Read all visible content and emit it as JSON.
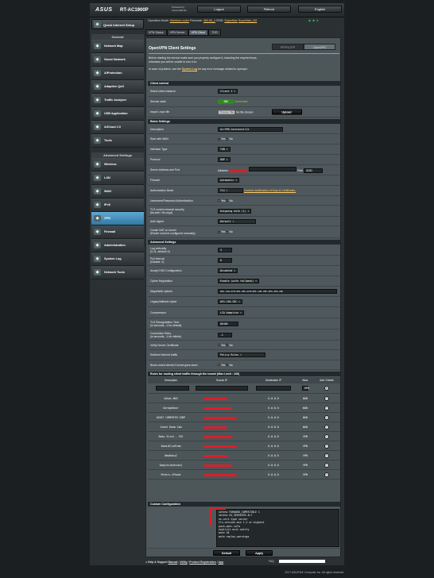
{
  "header": {
    "brand": "ASUS",
    "model": "RT-AC1900P",
    "powered_line1": "Powered by",
    "powered_line2": "AsuswrtMerlin",
    "logout": "Logout",
    "reboot": "Reboot",
    "language": "English"
  },
  "opmode": {
    "label": "Operation Mode:",
    "mode": "Wireless router",
    "fw_label": "Firmware:",
    "fw": "380.68_4",
    "ssid_label": "SSID:",
    "ssid1": "SuperMan",
    "ssid2": "SuperMan_5G"
  },
  "sidebar": {
    "qis": "Quick Internet Setup",
    "general": "General",
    "general_items": [
      {
        "label": "Network Map",
        "icon": "network-map-icon"
      },
      {
        "label": "Guest Network",
        "icon": "guest-network-icon"
      },
      {
        "label": "AiProtection",
        "icon": "shield-icon"
      },
      {
        "label": "Adaptive QoS",
        "icon": "qos-icon"
      },
      {
        "label": "Traffic Analyzer",
        "icon": "traffic-icon"
      },
      {
        "label": "USB Application",
        "icon": "usb-icon"
      },
      {
        "label": "AiCloud 2.0",
        "icon": "cloud-icon"
      },
      {
        "label": "Tools",
        "icon": "tools-icon"
      }
    ],
    "advanced": "Advanced Settings",
    "advanced_items": [
      {
        "label": "Wireless",
        "icon": "wireless-icon"
      },
      {
        "label": "LAN",
        "icon": "lan-icon"
      },
      {
        "label": "WAN",
        "icon": "wan-icon"
      },
      {
        "label": "IPv6",
        "icon": "ipv6-icon"
      },
      {
        "label": "VPN",
        "icon": "vpn-icon"
      },
      {
        "label": "Firewall",
        "icon": "firewall-icon"
      },
      {
        "label": "Administration",
        "icon": "admin-icon"
      },
      {
        "label": "System Log",
        "icon": "log-icon"
      },
      {
        "label": "Network Tools",
        "icon": "net-tools-icon"
      }
    ]
  },
  "tabs": [
    "VPN Status",
    "VPN Server",
    "VPN Client",
    "TOR"
  ],
  "page": {
    "title": "OpenVPN Client Settings",
    "switch_left": "PPTP/L2TP",
    "switch_right": "OpenVPN",
    "note1": "Before starting the service make sure you properly configure it, including the required keys,",
    "note2": "otherwise you will be unable to turn it on.",
    "note3a": "In case of problem, see the ",
    "note3_link": "System Log",
    "note3b": " for any error message related to openvpn."
  },
  "client_control": {
    "head": "Client control",
    "select_label": "Select client instance",
    "select_value": "Client 1",
    "state_label": "Service state",
    "state_value": "ON",
    "state_status": "Connected",
    "import_label": "Import .ovpn file",
    "choose": "Choose File",
    "no_file": "No file chosen",
    "upload": "Upload"
  },
  "basic": {
    "head": "Basic Settings",
    "desc_label": "Description",
    "desc_value": "AirVPN-Jacksonville",
    "start_label": "Start with WAN",
    "yes": "Yes",
    "no": "No",
    "iface_label": "Interface Type",
    "iface_value": "TUN",
    "proto_label": "Protocol",
    "proto_value": "UDP",
    "server_label": "Server Address and Port",
    "addr_label": "Address:",
    "port_label": "Port:",
    "port_value": "8282",
    "fw_label": "Firewall",
    "fw_value": "Automatic",
    "auth_label": "Authorization Mode",
    "auth_value": "TLS",
    "auth_link": "Content modification of Keys & Certificates.",
    "userpass_label": "Username/Password Authentication",
    "tls_label": "TLS control channel security\n(tls-auth / tls-crypt)",
    "tls_value": "Outgoing Auth (1)",
    "digest_label": "Auth digest",
    "digest_value": "Default",
    "nat_label": "Create NAT on tunnel\n(Router must be configured manually)"
  },
  "advanced": {
    "head": "Advanced Settings",
    "verb_label": "Log verbosity\n(0-11, default=3)",
    "verb_value": "3",
    "poll_label": "Poll Interval\n(Disable: 0)",
    "poll_value": "0",
    "dns_label": "Accept DNS Configuration",
    "dns_value": "Disabled",
    "cipher_neg_label": "Cipher Negotiation",
    "cipher_neg_value": "Enable (with fallback)",
    "ciphers_label": "Negotiable ciphers",
    "ciphers_value": "AES-128-GCM:AES-256-GCM:AES-128-CBC:AES-256-CBC",
    "legacy_label": "Legacy/fallback cipher",
    "legacy_value": "AES-256-CBC",
    "comp_label": "Compression",
    "comp_value": "LZO Adaptive",
    "reneg_label": "TLS Renegotiation Time\n(in seconds, -1 for default)",
    "reneg_value": "86400",
    "retry_label": "Connection Retry\n(in seconds, -1 for infinite)",
    "retry_value": "-1",
    "verify_label": "Verify Server Certificate",
    "redirect_label": "Redirect Internet traffic",
    "redirect_value": "Policy Rules",
    "block_label": "Block routed clients if tunnel goes down"
  },
  "rules": {
    "head": "Rules for routing client traffic through the tunnel (Max Limit : 100)",
    "cols": [
      "Description",
      "Source IP",
      "Destination IP",
      "Iface",
      "Add / Delete"
    ],
    "add_iface": "VPN",
    "rows": [
      {
        "desc": "Sakai-NAS",
        "dest": "0.0.0.0",
        "iface": "WAN"
      },
      {
        "desc": "GarageDoor",
        "dest": "0.0.0.0",
        "iface": "WAN"
      },
      {
        "desc": "ASUS7 COMPUTER CORP",
        "dest": "0.0.0.0",
        "iface": "WAN"
      },
      {
        "desc": "Great Room Cam",
        "dest": "0.0.0.0",
        "iface": "WAN"
      },
      {
        "desc": "Roku Stick - 192",
        "dest": "0.0.0.0",
        "iface": "VPN"
      },
      {
        "desc": "SakaiEliwPram",
        "dest": "0.0.0.0",
        "iface": "VPN"
      },
      {
        "desc": "NewRoku2",
        "dest": "0.0.0.0",
        "iface": "VPN"
      },
      {
        "desc": "Google(Android)",
        "dest": "0.0.0.0",
        "iface": "VPN"
      },
      {
        "desc": "Peters-iPhone",
        "dest": "0.0.0.0",
        "iface": "VPN"
      }
    ]
  },
  "custom": {
    "head": "Custom Configuration",
    "text": "setenv FORWARD_COMPATIBLE 1\nsetenv UV_SERVER33 ALT\nns-cert-type server\ntls-version-min 1.2 or-highest\npush-peer-info\nexplicit-exit-notify\nmute 20\nmute-replay-warnings"
  },
  "buttons": {
    "default": "Default",
    "apply": "Apply"
  },
  "footer": {
    "help": "Help & Support",
    "manual": "Manual",
    "utility": "Utility",
    "reg": "Product Registration",
    "app": "App",
    "faq": "FAQ",
    "copyright": "2017 ASUSTeK Computer Inc. All rights reserved."
  }
}
